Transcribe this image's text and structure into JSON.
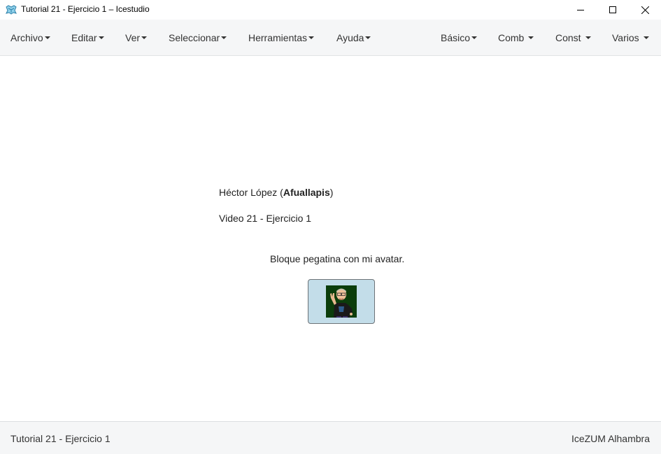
{
  "window": {
    "title": "Tutorial 21 - Ejercicio 1 – Icestudio",
    "icon": "icestudio-logo-icon",
    "controls": [
      "minimize-icon",
      "maximize-icon",
      "close-icon"
    ]
  },
  "menubar": {
    "left": [
      {
        "label": "Archivo"
      },
      {
        "label": "Editar"
      },
      {
        "label": "Ver"
      },
      {
        "label": "Seleccionar"
      },
      {
        "label": "Herramientas"
      },
      {
        "label": "Ayuda"
      }
    ],
    "right": [
      {
        "label": "Básico"
      },
      {
        "label": "Comb"
      },
      {
        "label": "Const"
      },
      {
        "label": "Varios"
      }
    ]
  },
  "canvas": {
    "author_name": "Héctor López (",
    "author_nick": "Afuallapis",
    "author_close": ")",
    "video": "Video 21 - Ejercicio 1",
    "caption": "Bloque pegatina con mi avatar.",
    "block_color": "#c3dde9"
  },
  "footer": {
    "project": "Tutorial 21 - Ejercicio 1",
    "board": "IceZUM Alhambra"
  }
}
